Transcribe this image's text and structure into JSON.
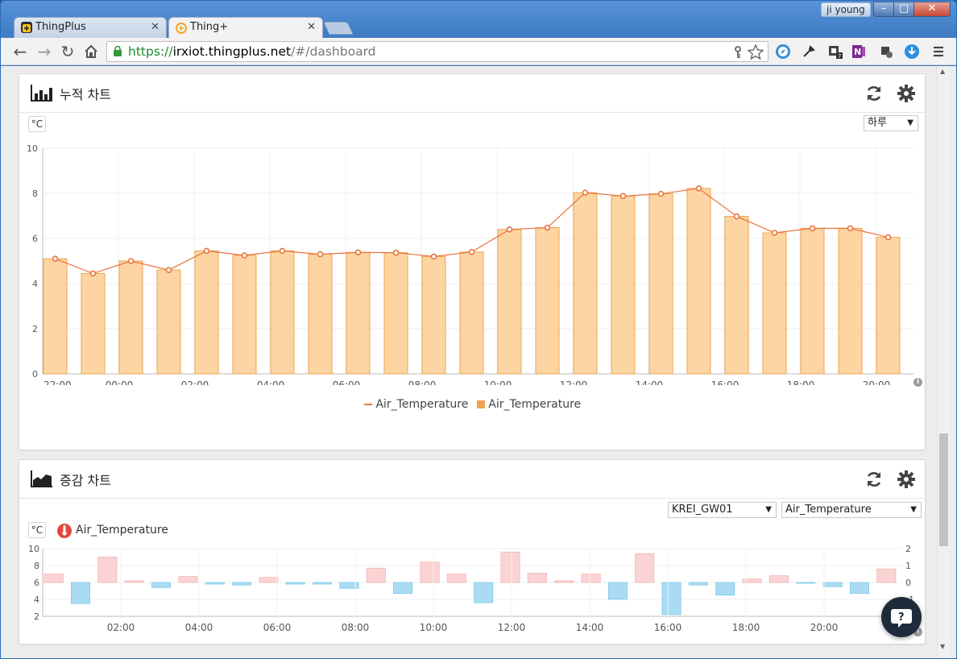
{
  "browser": {
    "user": "ji young",
    "tabs": [
      {
        "label": "ThingPlus"
      },
      {
        "label": "Thing+"
      }
    ],
    "url": {
      "scheme": "https://",
      "host": "irxiot.thingplus.net",
      "path": "/#/dashboard"
    }
  },
  "panel1": {
    "title": "누적 차트",
    "unit": "°C",
    "period": "하루",
    "legend_line": "Air_Temperature",
    "legend_bar": "Air_Temperature"
  },
  "panel2": {
    "title": "증감 차트",
    "unit": "°C",
    "gateway": "KREI_GW01",
    "sensor": "Air_Temperature",
    "sensor_label": "Air_Temperature"
  },
  "chart_data": [
    {
      "type": "bar",
      "x_tick_labels": [
        "22:00",
        "00:00",
        "02:00",
        "04:00",
        "06:00",
        "08:00",
        "10:00",
        "12:00",
        "14:00",
        "16:00",
        "18:00",
        "20:00"
      ],
      "categories": [
        "22:00",
        "23:00",
        "00:00",
        "01:00",
        "02:00",
        "03:00",
        "04:00",
        "05:00",
        "06:00",
        "07:00",
        "08:00",
        "09:00",
        "10:00",
        "11:00",
        "12:00",
        "13:00",
        "14:00",
        "15:00",
        "16:00",
        "17:00",
        "18:00",
        "19:00",
        "20:00"
      ],
      "series": [
        {
          "name": "Air_Temperature",
          "kind": "line",
          "values": [
            5.1,
            4.45,
            5.0,
            4.6,
            5.45,
            5.25,
            5.45,
            5.3,
            5.38,
            5.37,
            5.2,
            5.4,
            6.4,
            6.48,
            8.03,
            7.88,
            7.98,
            8.22,
            6.98,
            6.25,
            6.45,
            6.45,
            6.05
          ]
        },
        {
          "name": "Air_Temperature",
          "kind": "bar",
          "values": [
            5.1,
            4.45,
            5.0,
            4.6,
            5.45,
            5.25,
            5.45,
            5.3,
            5.38,
            5.37,
            5.2,
            5.4,
            6.4,
            6.48,
            8.03,
            7.88,
            7.98,
            8.22,
            6.98,
            6.25,
            6.45,
            6.45,
            6.05
          ]
        }
      ],
      "ylim": [
        0,
        10
      ],
      "y_ticks": [
        0,
        2,
        4,
        6,
        8,
        10
      ],
      "colors": {
        "bar_fill": "#fcd5a3",
        "bar_stroke": "#f0a24f",
        "line": "#e8743b"
      },
      "legend": "bottom-center",
      "grid": true
    },
    {
      "type": "bar",
      "x_tick_labels": [
        "02:00",
        "04:00",
        "06:00",
        "08:00",
        "10:00",
        "12:00",
        "14:00",
        "16:00",
        "18:00",
        "20:00"
      ],
      "y_ticks_left": [
        2,
        4,
        6,
        8,
        10
      ],
      "y_ticks_right": [
        2,
        1,
        0,
        -1
      ],
      "ylim_left": [
        2,
        10
      ],
      "ylim_right": [
        -2,
        2
      ],
      "deltas": [
        0.5,
        -1.25,
        1.5,
        0.1,
        -0.3,
        0.35,
        -0.1,
        -0.15,
        0.3,
        -0.1,
        -0.1,
        -0.35,
        0.85,
        -0.65,
        1.2,
        0.5,
        -1.2,
        1.8,
        0.55,
        0.1,
        0.5,
        -1.0,
        1.7,
        -1.9,
        -0.15,
        -0.75,
        0.2,
        0.4,
        -0.05,
        -0.25,
        -0.65,
        0.8
      ],
      "colors": {
        "positive": "#fbd3d3",
        "positive_stroke": "#f2a5a5",
        "negative": "#a9dcf3",
        "negative_stroke": "#6ec1e6"
      },
      "grid": true
    }
  ]
}
